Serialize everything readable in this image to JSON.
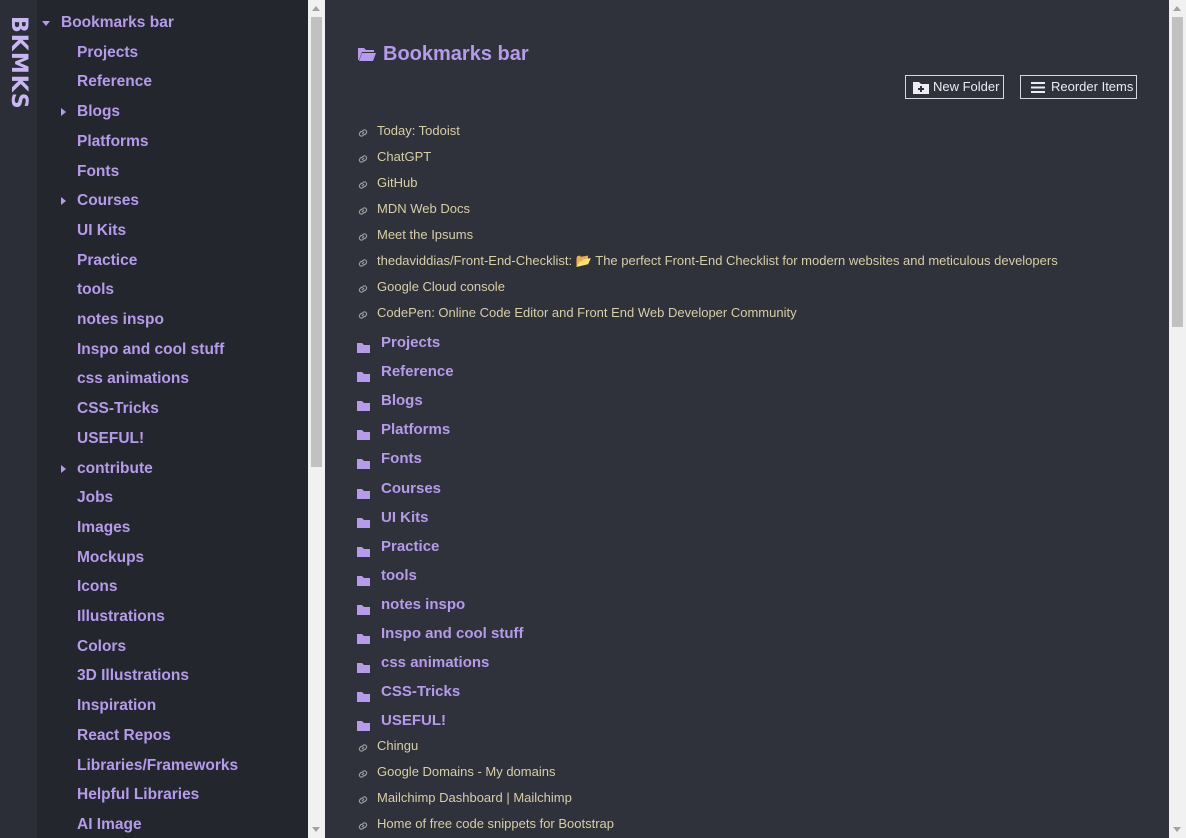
{
  "brand": {
    "name": "BKMKS"
  },
  "sidebar": {
    "items": [
      {
        "label": "Bookmarks bar",
        "caret": "down"
      },
      {
        "label": "Projects",
        "caret": ""
      },
      {
        "label": "Reference",
        "caret": ""
      },
      {
        "label": "Blogs",
        "caret": "right"
      },
      {
        "label": "Platforms",
        "caret": ""
      },
      {
        "label": "Fonts",
        "caret": ""
      },
      {
        "label": "Courses",
        "caret": "right"
      },
      {
        "label": "UI Kits",
        "caret": ""
      },
      {
        "label": "Practice",
        "caret": ""
      },
      {
        "label": "tools",
        "caret": ""
      },
      {
        "label": "notes inspo",
        "caret": ""
      },
      {
        "label": "Inspo and cool stuff",
        "caret": ""
      },
      {
        "label": "css animations",
        "caret": ""
      },
      {
        "label": "CSS-Tricks",
        "caret": ""
      },
      {
        "label": "USEFUL!",
        "caret": ""
      },
      {
        "label": "contribute",
        "caret": "right"
      },
      {
        "label": "Jobs",
        "caret": ""
      },
      {
        "label": "Images",
        "caret": ""
      },
      {
        "label": "Mockups",
        "caret": ""
      },
      {
        "label": "Icons",
        "caret": ""
      },
      {
        "label": "Illustrations",
        "caret": ""
      },
      {
        "label": "Colors",
        "caret": ""
      },
      {
        "label": "3D Illustrations",
        "caret": ""
      },
      {
        "label": "Inspiration",
        "caret": ""
      },
      {
        "label": "React Repos",
        "caret": ""
      },
      {
        "label": "Libraries/Frameworks",
        "caret": ""
      },
      {
        "label": "Helpful Libraries",
        "caret": ""
      },
      {
        "label": "AI Image",
        "caret": ""
      }
    ]
  },
  "main": {
    "title": "Bookmarks bar",
    "buttons": {
      "new_folder": "New Folder",
      "reorder": "Reorder Items"
    },
    "rows": [
      {
        "type": "link",
        "label": "Today: Todoist"
      },
      {
        "type": "link",
        "label": "ChatGPT"
      },
      {
        "type": "link",
        "label": "GitHub"
      },
      {
        "type": "link",
        "label": "MDN Web Docs"
      },
      {
        "type": "link",
        "label": "Meet the Ipsums"
      },
      {
        "type": "link",
        "label": "thedaviddias/Front-End-Checklist: 📂 The perfect Front-End Checklist for modern websites and meticulous developers"
      },
      {
        "type": "link",
        "label": "Google Cloud console"
      },
      {
        "type": "link",
        "label": "CodePen: Online Code Editor and Front End Web Developer Community"
      },
      {
        "type": "folder",
        "label": "Projects"
      },
      {
        "type": "folder",
        "label": "Reference"
      },
      {
        "type": "folder",
        "label": "Blogs"
      },
      {
        "type": "folder",
        "label": "Platforms"
      },
      {
        "type": "folder",
        "label": "Fonts"
      },
      {
        "type": "folder",
        "label": "Courses"
      },
      {
        "type": "folder",
        "label": "UI Kits"
      },
      {
        "type": "folder",
        "label": "Practice"
      },
      {
        "type": "folder",
        "label": "tools"
      },
      {
        "type": "folder",
        "label": "notes inspo"
      },
      {
        "type": "folder",
        "label": "Inspo and cool stuff"
      },
      {
        "type": "folder",
        "label": "css animations"
      },
      {
        "type": "folder",
        "label": "CSS-Tricks"
      },
      {
        "type": "folder",
        "label": "USEFUL!"
      },
      {
        "type": "link",
        "label": "Chingu"
      },
      {
        "type": "link",
        "label": "Google Domains - My domains"
      },
      {
        "type": "link",
        "label": "Mailchimp Dashboard | Mailchimp"
      },
      {
        "type": "link",
        "label": "Home of free code snippets for Bootstrap"
      }
    ]
  },
  "icons": {
    "open_folder": "folder-open-icon",
    "folder": "folder-icon",
    "link": "link-icon",
    "new_folder": "folder-plus-icon",
    "reorder": "menu-lines-icon"
  },
  "colors": {
    "accent": "#b59bea",
    "link_text": "#d7cfa5",
    "main_bg": "#2f313b",
    "sidebar_bg": "#24262e"
  }
}
